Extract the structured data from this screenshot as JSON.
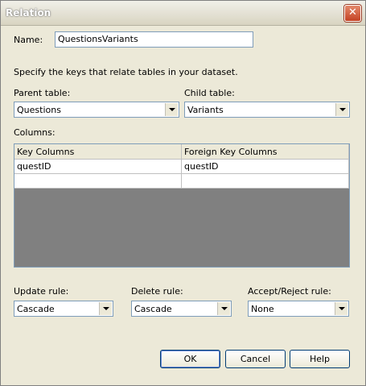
{
  "window": {
    "title": "Relation",
    "close_glyph": "✕"
  },
  "name": {
    "label": "Name:",
    "value": "QuestionsVariants"
  },
  "instructions": "Specify the keys that relate tables in your dataset.",
  "parent_table": {
    "label": "Parent table:",
    "value": "Questions"
  },
  "child_table": {
    "label": "Child table:",
    "value": "Variants"
  },
  "columns": {
    "label": "Columns:",
    "headers": [
      "Key Columns",
      "Foreign Key Columns"
    ],
    "rows": [
      [
        "questID",
        "questID"
      ],
      [
        "",
        ""
      ]
    ]
  },
  "update_rule": {
    "label": "Update rule:",
    "value": "Cascade"
  },
  "delete_rule": {
    "label": "Delete rule:",
    "value": "Cascade"
  },
  "accept_reject_rule": {
    "label": "Accept/Reject rule:",
    "value": "None"
  },
  "buttons": {
    "ok": "OK",
    "cancel": "Cancel",
    "help": "Help"
  }
}
